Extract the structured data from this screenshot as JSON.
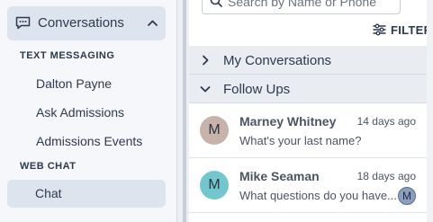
{
  "sidebar": {
    "header": {
      "title": "Conversations",
      "icon": "chat-bubble-icon",
      "caret_icon": "chevron-up-icon"
    },
    "sections": [
      {
        "label": "TEXT MESSAGING",
        "items": [
          "Dalton Payne",
          "Ask Admissions",
          "Admissions Events"
        ]
      },
      {
        "label": "WEB CHAT",
        "items": [
          "Chat"
        ]
      }
    ],
    "selected_item": "Chat"
  },
  "search": {
    "placeholder": "Search by Name or Phone"
  },
  "filter": {
    "label": "FILTER",
    "icon": "sliders-icon"
  },
  "groups": [
    {
      "label": "My Conversations",
      "state": "collapsed"
    },
    {
      "label": "Follow Ups",
      "state": "expanded"
    }
  ],
  "conversations": [
    {
      "name": "Marney Whitney",
      "time": "14 days ago",
      "preview": "What's your last name?",
      "avatar_letter": "M",
      "avatar_color": "#c7b3aa"
    },
    {
      "name": "Mike Seaman",
      "time": "18 days ago",
      "preview": "What questions do you have...",
      "avatar_letter": "M",
      "avatar_color": "#72c6ce",
      "agent_letter": "M"
    }
  ],
  "colors": {
    "sidebar_bg": "#f5f7fa",
    "selected_bg": "#dde4ee",
    "group_bg": "#e9ecf0",
    "text": "#2c3a4d"
  }
}
